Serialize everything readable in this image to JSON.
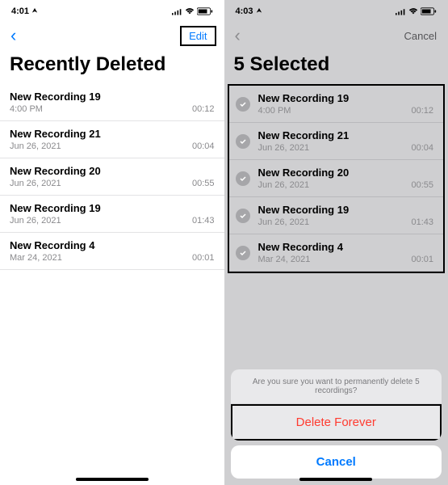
{
  "left": {
    "time": "4:01",
    "nav_edit": "Edit",
    "title": "Recently Deleted",
    "items": [
      {
        "title": "New Recording 19",
        "sub": "4:00 PM",
        "dur": "00:12"
      },
      {
        "title": "New Recording 21",
        "sub": "Jun 26, 2021",
        "dur": "00:04"
      },
      {
        "title": "New Recording 20",
        "sub": "Jun 26, 2021",
        "dur": "00:55"
      },
      {
        "title": "New Recording 19",
        "sub": "Jun 26, 2021",
        "dur": "01:43"
      },
      {
        "title": "New Recording 4",
        "sub": "Mar 24, 2021",
        "dur": "00:01"
      }
    ]
  },
  "right": {
    "time": "4:03",
    "nav_cancel": "Cancel",
    "title": "5 Selected",
    "items": [
      {
        "title": "New Recording 19",
        "sub": "4:00 PM",
        "dur": "00:12"
      },
      {
        "title": "New Recording 21",
        "sub": "Jun 26, 2021",
        "dur": "00:04"
      },
      {
        "title": "New Recording 20",
        "sub": "Jun 26, 2021",
        "dur": "00:55"
      },
      {
        "title": "New Recording 19",
        "sub": "Jun 26, 2021",
        "dur": "01:43"
      },
      {
        "title": "New Recording 4",
        "sub": "Mar 24, 2021",
        "dur": "00:01"
      }
    ],
    "sheet_msg": "Are you sure you want to permanently delete 5 recordings?",
    "sheet_delete": "Delete Forever",
    "sheet_cancel": "Cancel"
  }
}
